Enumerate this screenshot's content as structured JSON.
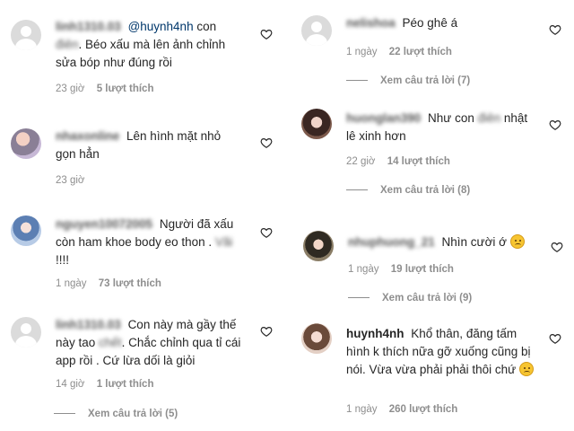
{
  "left_comments": [
    {
      "username": "linh1310.03",
      "mention": "@huynh4nh",
      "text_before": " con ",
      "blurred_word": "điên",
      "text_after": ". Béo xấu mà lên ảnh chỉnh sửa bóp như đúng rồi",
      "time": "23 giờ",
      "likes": "5 lượt thích"
    },
    {
      "username": "nhaxonline",
      "text": "Lên hình mặt nhỏ gọn hẳn",
      "time": "23 giờ"
    },
    {
      "username": "nguyen10072005",
      "text_before": "Người đã xấu còn ham khoe body eo thon . ",
      "blurred_word": "Vãi",
      "text_after": "!!!!",
      "time": "1 ngày",
      "likes": "73 lượt thích"
    },
    {
      "username": "linh1310.03",
      "text_before": "Con này mà gầy thế này tao ",
      "blurred_word": "chết",
      "text_after": ". Chắc chỉnh qua tỉ cái app rồi . Cứ lừa dối là giỏi",
      "time": "14 giờ",
      "likes": "1 lượt thích",
      "replies": "Xem câu trả lời (5)"
    }
  ],
  "right_comments": [
    {
      "username": "nelishoa",
      "text": "Péo ghê á",
      "time": "1 ngày",
      "likes": "22 lượt thích",
      "replies": "Xem câu trả lời (7)"
    },
    {
      "username": "huonglan390",
      "text_before": "Như con ",
      "blurred_word": "điên",
      "text_after": " nhật lê xinh hơn",
      "time": "22 giờ",
      "likes": "14 lượt thích",
      "replies": "Xem câu trả lời (8)"
    },
    {
      "username": "nhuphuong_21",
      "text": "Nhìn cười ớ",
      "time": "1 ngày",
      "likes": "19 lượt thích",
      "replies": "Xem câu trả lời (9)"
    },
    {
      "username": "huynh4nh",
      "text": "Khổ thân, đăng tấm hình k thích nữa gỡ xuống cũng bị nói. Vừa vừa phải phải thôi chứ",
      "time": "1 ngày",
      "likes": "260 lượt thích"
    }
  ],
  "icons": {
    "heart": "heart-outline-icon",
    "emoji": "worried-face-emoji"
  },
  "colors": {
    "text": "#262626",
    "meta": "#8e8e8e",
    "mention": "#00376b"
  }
}
